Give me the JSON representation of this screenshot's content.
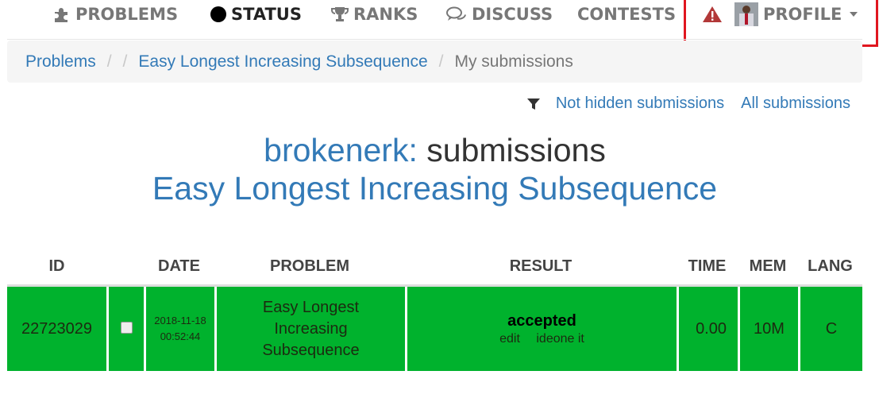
{
  "nav": {
    "problems": "PROBLEMS",
    "status": "STATUS",
    "ranks": "RANKS",
    "discuss": "DISCUSS",
    "contests": "CONTESTS",
    "profile": "PROFILE",
    "icons": [
      "puzzle-icon",
      "status-dot-icon",
      "trophy-icon",
      "comments-icon",
      "warning-icon",
      "avatar",
      "caret-down-icon"
    ]
  },
  "breadcrumb": {
    "problems": "Problems",
    "sep": "/",
    "problem": "Easy Longest Increasing Subsequence",
    "current": "My submissions"
  },
  "filters": {
    "not_hidden": "Not hidden submissions",
    "all": "All submissions"
  },
  "heading": {
    "user": "brokenerk:",
    "label": "submissions",
    "problem": "Easy Longest Increasing Subsequence"
  },
  "table": {
    "headers": {
      "id": "ID",
      "date": "DATE",
      "problem": "PROBLEM",
      "result": "RESULT",
      "time": "TIME",
      "mem": "MEM",
      "lang": "LANG"
    },
    "rows": [
      {
        "id": "22723029",
        "date": "2018-11-18",
        "time_of_day": "00:52:44",
        "problem_line1": "Easy Longest",
        "problem_line2": "Increasing",
        "problem_line3": "Subsequence",
        "result": "accepted",
        "edit": "edit",
        "ideone": "ideone it",
        "time": "0.00",
        "mem": "10M",
        "lang": "C"
      }
    ]
  },
  "colors": {
    "accepted_bg": "#00b22d",
    "link": "#337ab7",
    "highlight": "#e0161f"
  }
}
